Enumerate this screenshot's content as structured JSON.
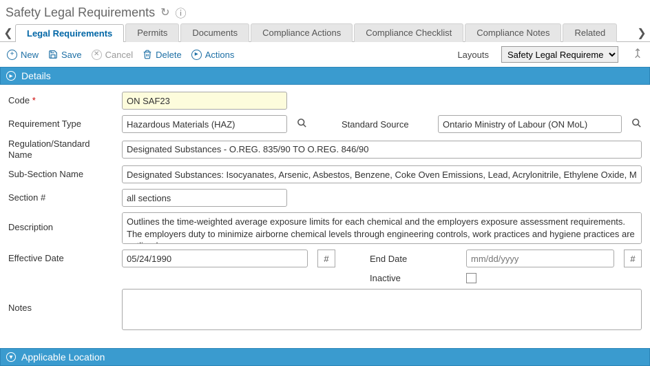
{
  "header": {
    "title": "Safety Legal Requirements"
  },
  "tabs": [
    {
      "label": "Legal Requirements",
      "active": true
    },
    {
      "label": "Permits"
    },
    {
      "label": "Documents"
    },
    {
      "label": "Compliance Actions"
    },
    {
      "label": "Compliance Checklist"
    },
    {
      "label": "Compliance Notes"
    },
    {
      "label": "Related"
    }
  ],
  "toolbar": {
    "new_label": "New",
    "save_label": "Save",
    "cancel_label": "Cancel",
    "delete_label": "Delete",
    "actions_label": "Actions",
    "layouts_label": "Layouts",
    "layouts_value": "Safety Legal Requireme..."
  },
  "sections": {
    "details": "Details",
    "applicable_location": "Applicable Location"
  },
  "form": {
    "code_label": "Code",
    "code_value": "ON SAF23",
    "req_type_label": "Requirement Type",
    "req_type_value": "Hazardous Materials (HAZ)",
    "std_source_label": "Standard Source",
    "std_source_value": "Ontario Ministry of Labour (ON MoL)",
    "reg_name_label": "Regulation/Standard Name",
    "reg_name_value": "Designated Substances - O.REG. 835/90 TO O.REG. 846/90",
    "subsection_label": "Sub-Section Name",
    "subsection_value": "Designated Substances: Isocyanates, Arsenic, Asbestos, Benzene, Coke Oven Emissions, Lead, Acrylonitrile, Ethylene Oxide, Mercury, Silica",
    "section_num_label": "Section #",
    "section_num_value": "all sections",
    "description_label": "Description",
    "description_value": "Outlines the time-weighted average exposure limits for each chemical and the employers exposure assessment requirements. The employers duty to minimize airborne chemical levels through engineering controls, work practices and hygiene practices are outlined",
    "eff_date_label": "Effective Date",
    "eff_date_value": "05/24/1990",
    "end_date_label": "End Date",
    "end_date_placeholder": "mm/dd/yyyy",
    "inactive_label": "Inactive",
    "notes_label": "Notes",
    "notes_value": ""
  }
}
